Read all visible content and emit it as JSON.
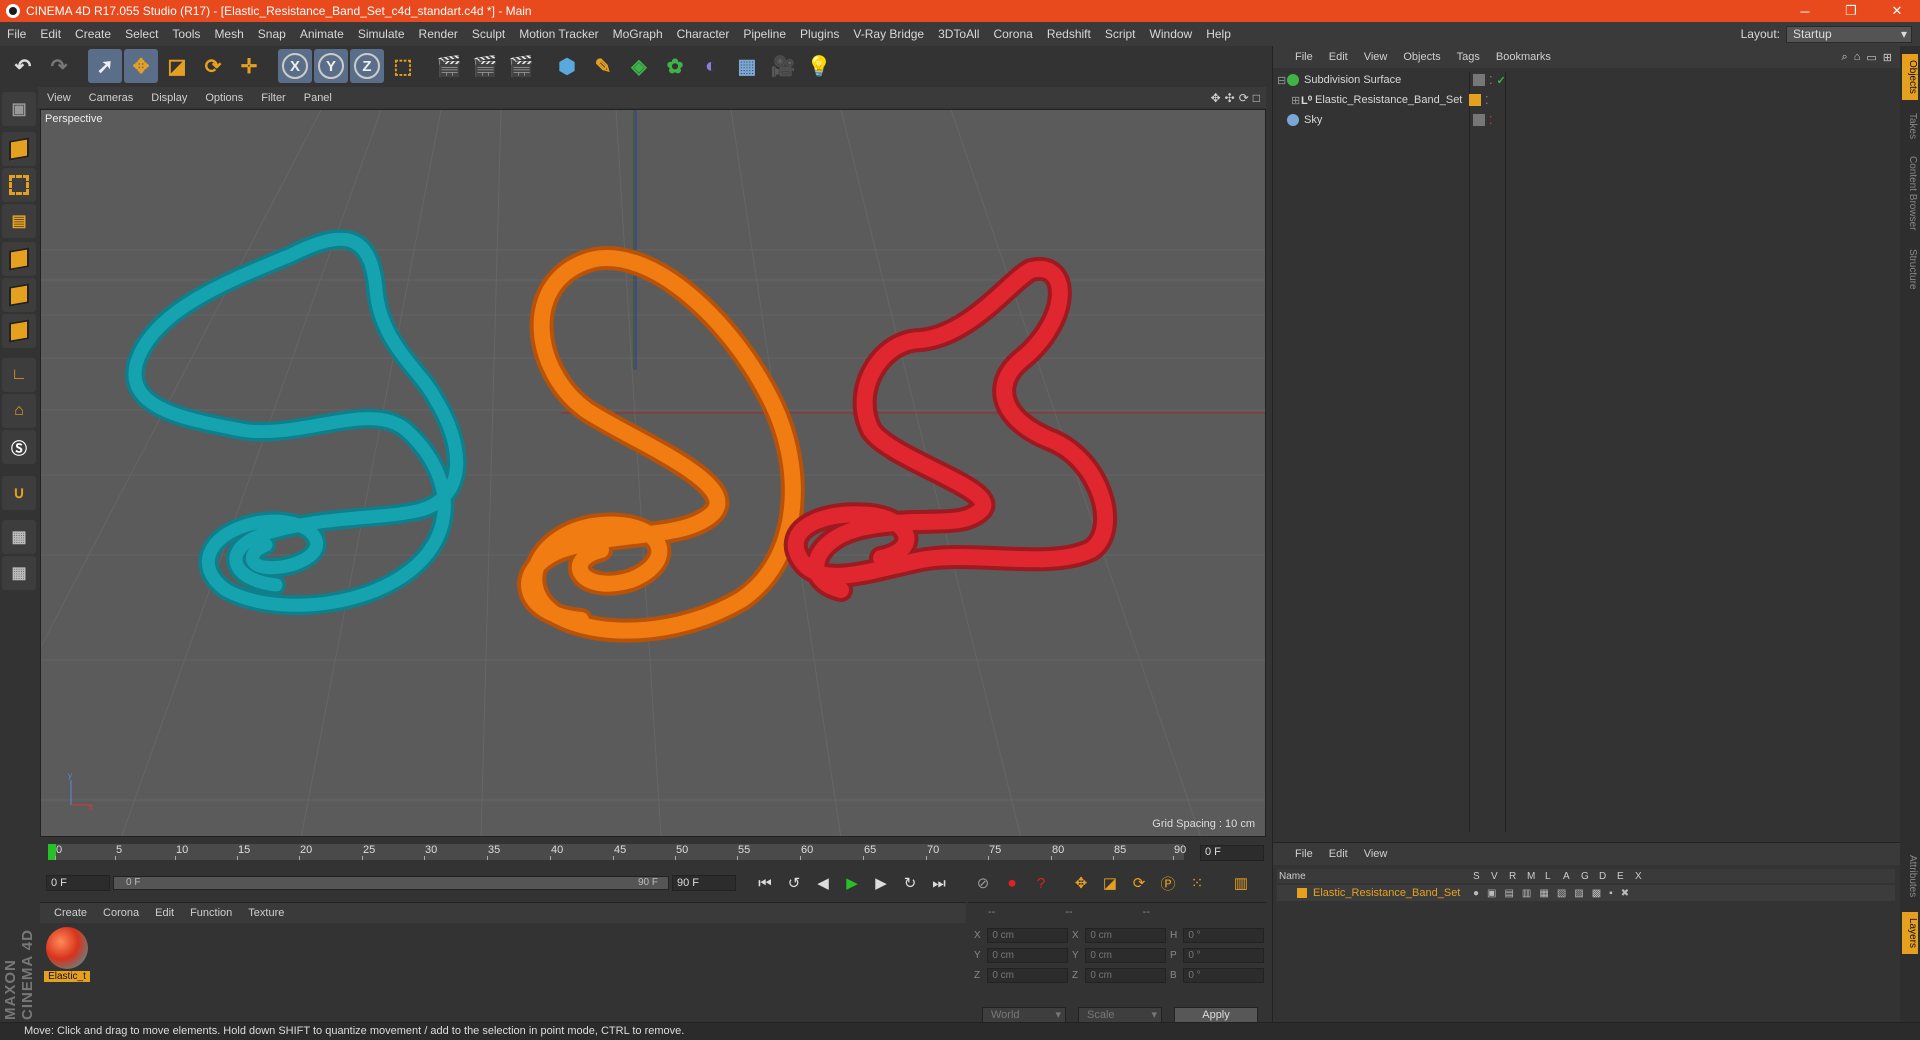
{
  "titlebar": {
    "title": "CINEMA 4D R17.055 Studio (R17) - [Elastic_Resistance_Band_Set_c4d_standart.c4d *] - Main",
    "minimize": "─",
    "restore": "❐",
    "close": "✕"
  },
  "menubar": {
    "items": [
      "File",
      "Edit",
      "Create",
      "Select",
      "Tools",
      "Mesh",
      "Snap",
      "Animate",
      "Simulate",
      "Render",
      "Sculpt",
      "Motion Tracker",
      "MoGraph",
      "Character",
      "Pipeline",
      "Plugins",
      "V-Ray Bridge",
      "3DToAll",
      "Corona",
      "Redshift",
      "Script",
      "Window",
      "Help"
    ],
    "layout_label": "Layout:",
    "layout_value": "Startup"
  },
  "viewport": {
    "menu": [
      "View",
      "Cameras",
      "Display",
      "Options",
      "Filter",
      "Panel"
    ],
    "label": "Perspective",
    "grid_spacing": "Grid Spacing : 10 cm",
    "nav_icons": [
      "✥",
      "✣",
      "⟳",
      "□"
    ]
  },
  "timeline": {
    "ticks": [
      "0",
      "5",
      "10",
      "15",
      "20",
      "25",
      "30",
      "35",
      "40",
      "45",
      "50",
      "55",
      "60",
      "65",
      "70",
      "75",
      "80",
      "85",
      "90"
    ],
    "frame_display": "0 F",
    "start_frame": "0 F",
    "slider_start": "0 F",
    "slider_end": "90 F",
    "end_frame": "90 F"
  },
  "material_panel": {
    "menu": [
      "Create",
      "Corona",
      "Edit",
      "Function",
      "Texture"
    ],
    "material_name": "Elastic_t"
  },
  "coord_panel": {
    "headers": [
      "--",
      "--",
      "--"
    ],
    "rows": [
      {
        "a": "X",
        "av": "0 cm",
        "b": "X",
        "bv": "0 cm",
        "c": "H",
        "cv": "0 °"
      },
      {
        "a": "Y",
        "av": "0 cm",
        "b": "Y",
        "bv": "0 cm",
        "c": "P",
        "cv": "0 °"
      },
      {
        "a": "Z",
        "av": "0 cm",
        "b": "Z",
        "bv": "0 cm",
        "c": "B",
        "cv": "0 °"
      }
    ],
    "world": "World",
    "scale": "Scale",
    "apply": "Apply"
  },
  "object_panel": {
    "menu": [
      "File",
      "Edit",
      "View",
      "Objects",
      "Tags",
      "Bookmarks"
    ],
    "objects": [
      {
        "name": "Subdivision Surface",
        "color": "#3fb24a"
      },
      {
        "name": "Elastic_Resistance_Band_Set",
        "color": "#cfcfcf"
      },
      {
        "name": "Sky",
        "color": "#7aa7d6"
      }
    ]
  },
  "layer_panel": {
    "menu": [
      "File",
      "Edit",
      "View"
    ],
    "columns": [
      "Name",
      "S",
      "V",
      "R",
      "M",
      "L",
      "A",
      "G",
      "D",
      "E",
      "X"
    ],
    "layer_name": "Elastic_Resistance_Band_Set"
  },
  "right_tabs": [
    "Objects",
    "Takes",
    "Content Browser",
    "Structure",
    "Attributes",
    "Layers"
  ],
  "statusbar": "Move: Click and drag to move elements. Hold down SHIFT to quantize movement / add to the selection in point mode, CTRL to remove.",
  "colors": {
    "accent": "#e6a020",
    "titlebar": "#e8491d",
    "band_teal": "#16a3b0",
    "band_orange": "#f07c12",
    "band_red": "#e0262f"
  }
}
